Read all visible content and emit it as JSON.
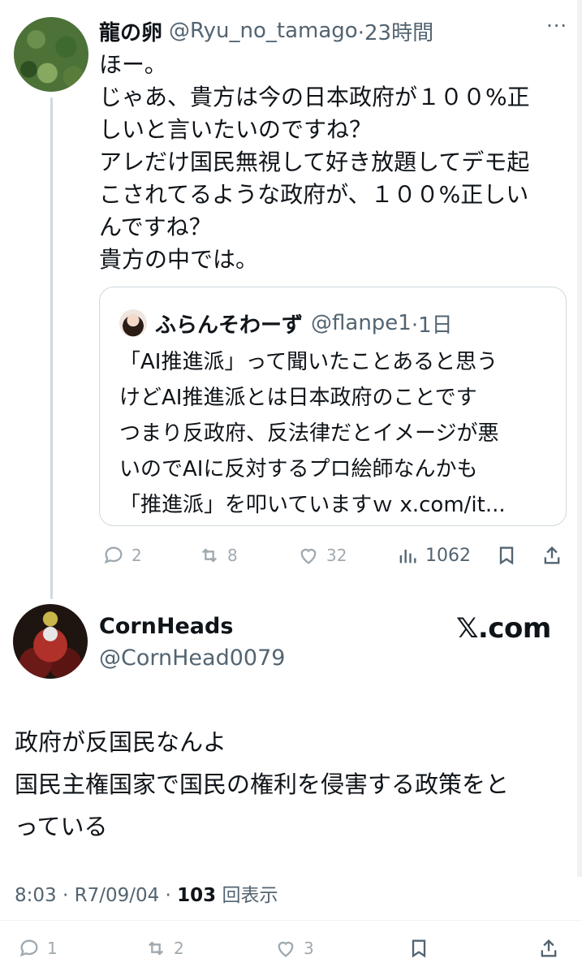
{
  "quoted_reply": {
    "author_name": "龍の卵",
    "author_handle": "@Ryu_no_tamago",
    "time": "·23時間",
    "more_icon": "more-horizontal-icon",
    "text_lines": [
      "ほー。",
      "じゃあ、貴方は今の日本政府が１００%正",
      "しいと言いたいのですね？",
      "アレだけ国民無視して好き放題してデモ起",
      "こされてるような政府が、１００%正しい",
      "んですね？",
      "貴方の中では。"
    ],
    "quote": {
      "author_name": "ふらんそわーず",
      "author_handle": "@flanpe1",
      "time": "·1日",
      "text_lines": [
        "「AI推進派」って聞いたことあると思う",
        "けどAI推進派とは日本政府のことです",
        "つまり反政府、反法律だとイメージが悪",
        "いのでAIに反対するプロ絵師なんかも",
        "「推進派」を叩いていますｗ x.com/it..."
      ]
    },
    "actions": {
      "reply_count": "2",
      "repost_count": "8",
      "like_count": "32",
      "view_count": "1062"
    }
  },
  "main_tweet": {
    "author_name": "CornHeads",
    "author_handle": "@CornHead0079",
    "brand": "𝕏.com",
    "text_lines": [
      "政府が反国民なんよ",
      "国民主権国家で国民の権利を侵害する政策をと",
      "っている"
    ],
    "meta": {
      "time": "8:03",
      "date": "· R7/09/04 ·",
      "views": "103",
      "views_label": "回表示"
    },
    "actions": {
      "reply_count": "1",
      "repost_count": "2",
      "like_count": "3"
    }
  }
}
